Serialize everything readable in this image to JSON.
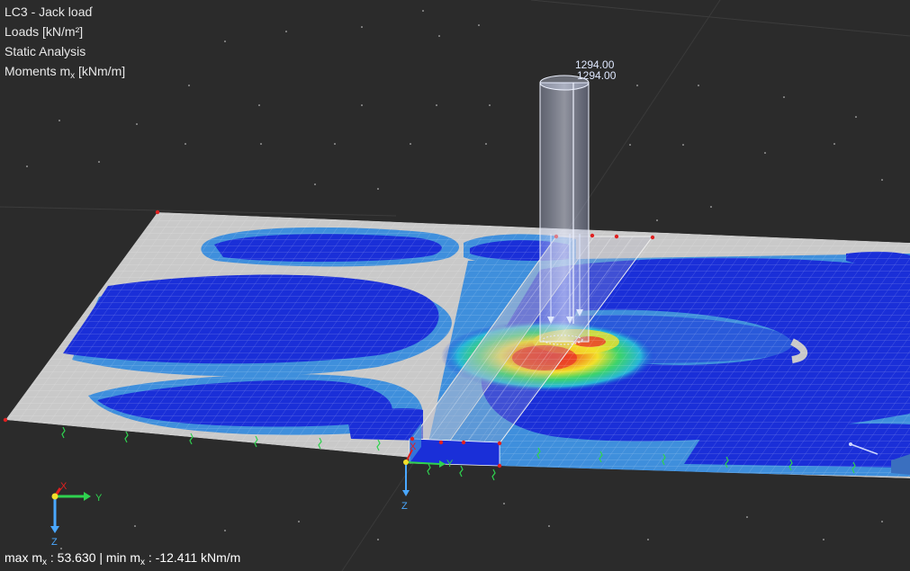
{
  "info": {
    "load_case": "LC3 - Jack load",
    "loads_label": "Loads [kN/m²]",
    "analysis": "Static Analysis",
    "result_main": "Moments m",
    "result_sub": "x",
    "result_unit": " [kNm/m]"
  },
  "load_values": {
    "value_1": "1294.00",
    "value_2": "1294.00"
  },
  "footer": {
    "max_label": "max m",
    "max_sub": "x",
    "max_value": " : 53.630 | min m",
    "min_sub": "x",
    "min_value": " : -12.411 kNm/m"
  },
  "axes": {
    "x": "X",
    "y": "Y",
    "z": "Z"
  },
  "colors": {
    "background": "#2b2b2b",
    "slab_neutral": "#c9c9c9",
    "band_light_blue": "#3f8fdc",
    "band_dark_blue": "#1a2fd8",
    "hotspot_red": "#e8362a",
    "hotspot_yellow": "#f2e02a",
    "hotspot_green": "#3dd36b",
    "support_green": "#2fd24f",
    "node_red": "#e02020"
  },
  "icons": [
    "coordinate-axes-icon",
    "origin-axes-icon",
    "support-spring-icon",
    "load-arrow-icon"
  ]
}
